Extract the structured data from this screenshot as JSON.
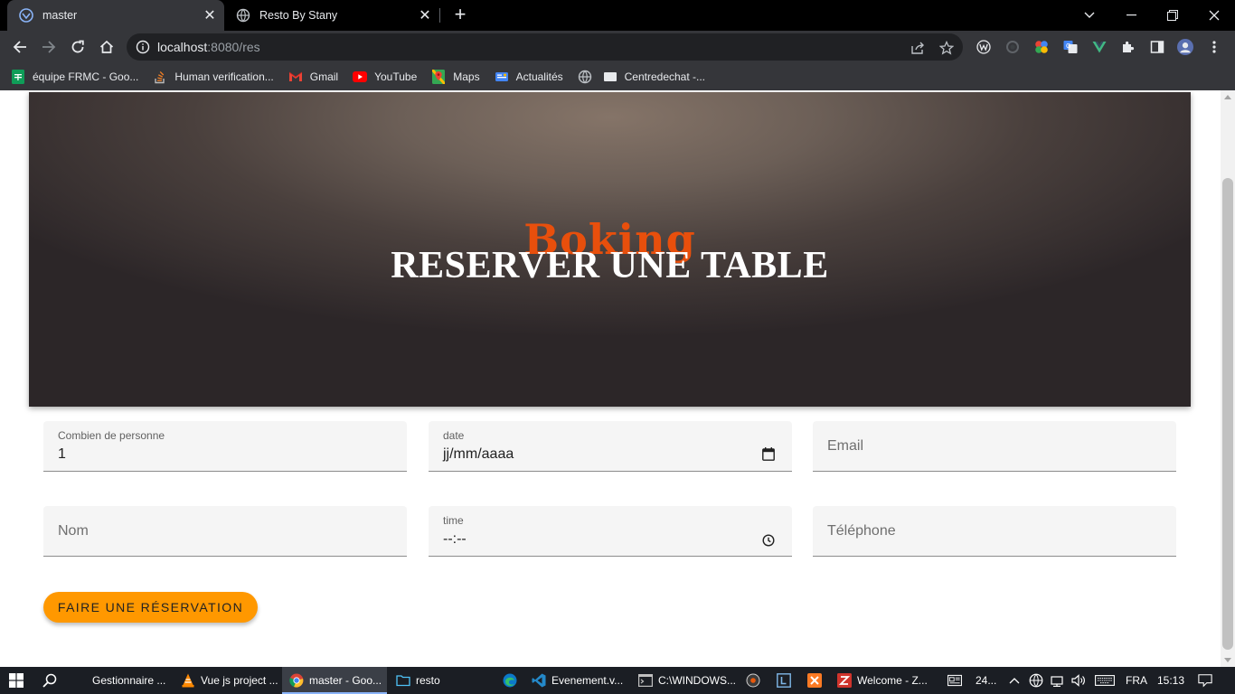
{
  "browser": {
    "tabs": [
      {
        "title": "master",
        "icon": "tab-favicon-icon"
      },
      {
        "title": "Resto By Stany",
        "icon": "globe-icon"
      }
    ],
    "url_host": "localhost",
    "url_path": ":8080/res",
    "bookmarks": [
      {
        "label": "équipe FRMC - Goo...",
        "icon": "sheets-icon"
      },
      {
        "label": "Human verification...",
        "icon": "stackoverflow-icon"
      },
      {
        "label": "Gmail",
        "icon": "gmail-icon"
      },
      {
        "label": "YouTube",
        "icon": "youtube-icon"
      },
      {
        "label": "Maps",
        "icon": "maps-icon"
      },
      {
        "label": "Actualités",
        "icon": "news-icon"
      },
      {
        "label": "",
        "icon": "globe-icon"
      },
      {
        "label": "Centredechat -...",
        "icon": "page-icon"
      }
    ]
  },
  "hero": {
    "subtitle": "Boking",
    "title": "RESERVER UNE TABLE"
  },
  "form": {
    "persons": {
      "label": "Combien de personne",
      "value": "1"
    },
    "date": {
      "label": "date",
      "value": "jj/mm/aaaa"
    },
    "email": {
      "placeholder": "Email"
    },
    "nom": {
      "placeholder": "Nom"
    },
    "time": {
      "label": "time",
      "value": "--:--"
    },
    "telephone": {
      "placeholder": "Téléphone"
    },
    "submit_label": "FAIRE UNE RÉSERVATION"
  },
  "colors": {
    "accent_button": "#ff9800",
    "hero_subtitle": "#e84f0c"
  },
  "taskbar": {
    "items": [
      {
        "label": "Gestionnaire ..."
      },
      {
        "label": "Vue js project ..."
      },
      {
        "label": "master - Goo..."
      },
      {
        "label": "resto"
      },
      {
        "label": "Evenement.v..."
      },
      {
        "label": "C:\\WINDOWS..."
      },
      {
        "label": "Welcome - Z..."
      }
    ],
    "weather": "24...",
    "language": "FRA",
    "time": "15:13"
  }
}
